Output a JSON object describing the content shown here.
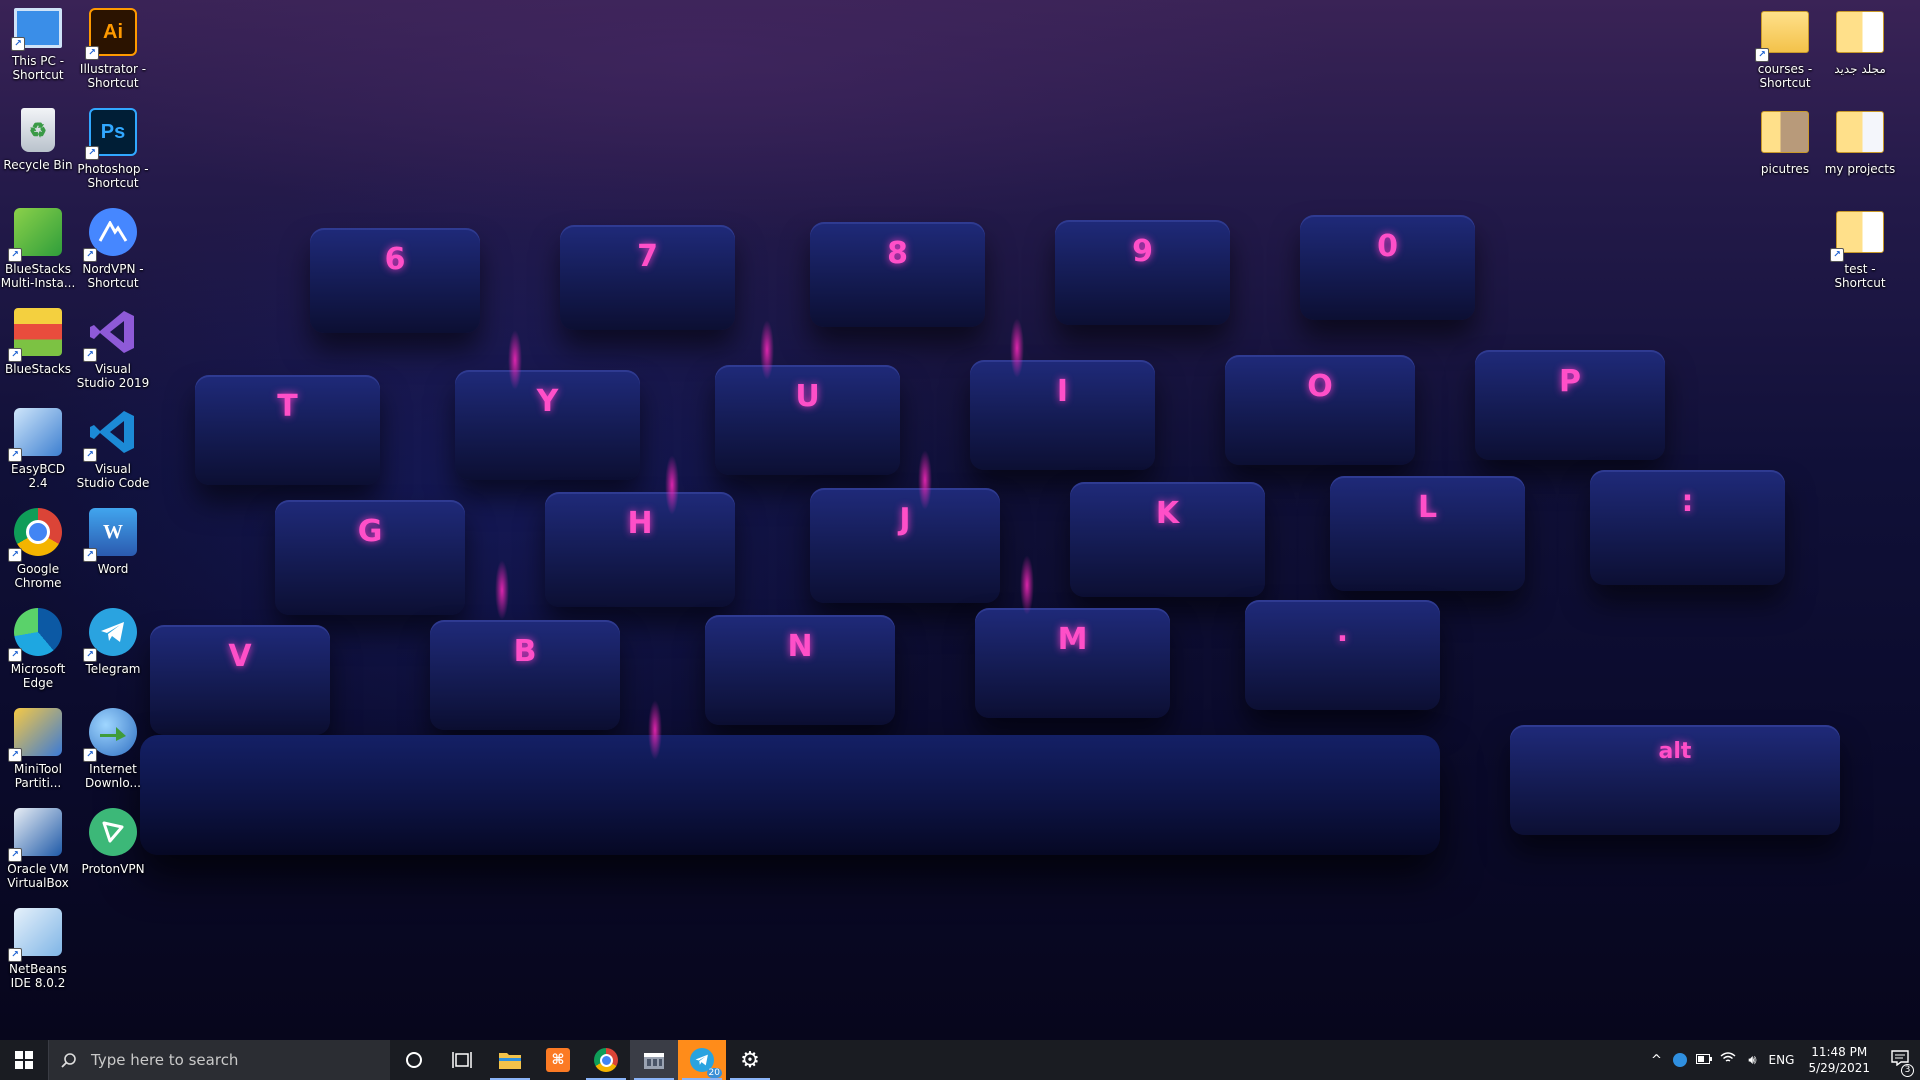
{
  "desktop": {
    "icons_left": [
      {
        "label": "This PC - Shortcut",
        "icon": "computer-icon",
        "color": "#3a8ee8"
      },
      {
        "label": "Recycle Bin",
        "icon": "recycle-bin-icon",
        "color": "#d8dde4"
      },
      {
        "label": "BlueStacks Multi-Insta...",
        "icon": "bluestacks-multi-icon",
        "color": "#4caf50"
      },
      {
        "label": "BlueStacks",
        "icon": "bluestacks-icon",
        "color": "#7cc243"
      },
      {
        "label": "EasyBCD 2.4",
        "icon": "easybcd-icon",
        "color": "#5aa0e0"
      },
      {
        "label": "Google Chrome",
        "icon": "chrome-icon",
        "color": "#db4437"
      },
      {
        "label": "Microsoft Edge",
        "icon": "edge-icon",
        "color": "#1ea7e1"
      },
      {
        "label": "MiniTool Partiti...",
        "icon": "minitool-icon",
        "color": "#3b7ad6"
      },
      {
        "label": "Oracle VM VirtualBox",
        "icon": "virtualbox-icon",
        "color": "#1f5aa8"
      },
      {
        "label": "NetBeans IDE 8.0.2",
        "icon": "netbeans-icon",
        "color": "#7fb5e6"
      }
    ],
    "icons_col2": [
      {
        "label": "Illustrator - Shortcut",
        "icon": "illustrator-icon",
        "glyph": "Ai",
        "color": "#2b1300",
        "fg": "#ff9a00"
      },
      {
        "label": "Photoshop - Shortcut",
        "icon": "photoshop-icon",
        "glyph": "Ps",
        "color": "#001e36",
        "fg": "#31a8ff"
      },
      {
        "label": "NordVPN - Shortcut",
        "icon": "nordvpn-icon",
        "glyph": "",
        "color": "#4687ff",
        "fg": "#ffffff"
      },
      {
        "label": "Visual Studio 2019",
        "icon": "visual-studio-icon",
        "glyph": "",
        "color": "#7b4fc9",
        "fg": "#ffffff"
      },
      {
        "label": "Visual Studio Code",
        "icon": "vscode-icon",
        "glyph": "",
        "color": "#1c8ad6",
        "fg": "#ffffff"
      },
      {
        "label": "Word",
        "icon": "word-icon",
        "glyph": "W",
        "color": "#2b5aaf",
        "fg": "#ffffff"
      },
      {
        "label": "Telegram",
        "icon": "telegram-icon",
        "glyph": "",
        "color": "#2aa3e0",
        "fg": "#ffffff"
      },
      {
        "label": "Internet Downlo...",
        "icon": "idm-icon",
        "glyph": "",
        "color": "#3f9c3a",
        "fg": "#ffffff"
      },
      {
        "label": "ProtonVPN",
        "icon": "protonvpn-icon",
        "glyph": "",
        "color": "#3cb878",
        "fg": "#ffffff"
      }
    ],
    "icons_right": [
      {
        "label": "courses - Shortcut",
        "icon": "folder-icon"
      },
      {
        "label": "مجلد جديد",
        "icon": "folder-icon"
      },
      {
        "label": "picutres",
        "icon": "folder-icon"
      },
      {
        "label": "my projects",
        "icon": "folder-icon"
      },
      {
        "label": "test - Shortcut",
        "icon": "folder-icon"
      }
    ],
    "keys": [
      "6",
      "7",
      "8",
      "9",
      "0",
      "T",
      "Y",
      "U",
      "I",
      "O",
      "P",
      "G",
      "H",
      "J",
      "K",
      "L",
      ":",
      "V",
      "B",
      "N",
      "M",
      ".",
      "alt"
    ]
  },
  "taskbar": {
    "search_placeholder": "Type here to search",
    "apps": [
      "file-explorer",
      "xampp",
      "chrome",
      "app-window",
      "telegram",
      "settings"
    ],
    "telegram_badge": "20",
    "language": "ENG",
    "time": "11:48 PM",
    "date": "5/29/2021",
    "notifications_count": "3"
  }
}
